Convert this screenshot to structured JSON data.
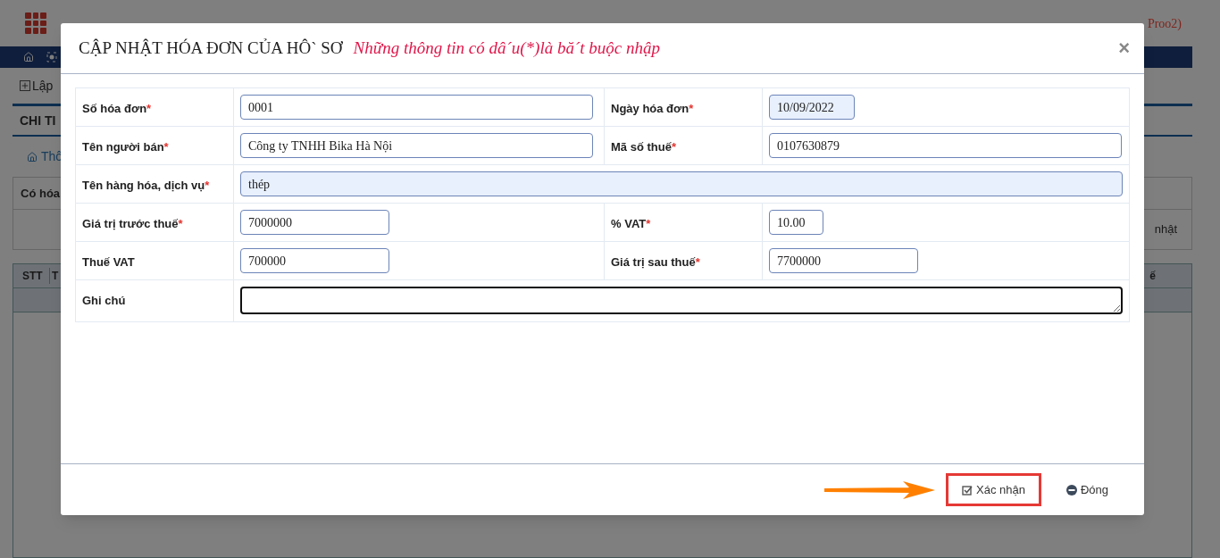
{
  "background": {
    "user_fragments": [
      "Proo2)"
    ],
    "create_link": "Lập",
    "section_title": "CHI TI",
    "breadcrumb": "Thô",
    "filter_label": "Có hóa",
    "update_fragment": "nhật",
    "table_headers": [
      "STT",
      "T",
      "ế"
    ]
  },
  "dialog": {
    "title": "CẬP NHẬT HÓA ĐƠN CỦA HÔ` SƠ",
    "note": "Những thông tin có dâ´u(*)là bă´t buộc nhập",
    "close": "×",
    "rows": [
      {
        "fields": [
          {
            "label": "Số hóa đơn",
            "required_mark": "*",
            "value": "0001",
            "kind": "wide",
            "highlighted": false
          },
          {
            "label": "Ngày hóa đơn",
            "required_mark": "*",
            "value": "10/09/2022",
            "kind": "date",
            "highlighted": true
          }
        ]
      },
      {
        "fields": [
          {
            "label": "Tên người bán",
            "required_mark": "*",
            "value": "Công ty TNHH Bika Hà Nội",
            "kind": "wide",
            "highlighted": false
          },
          {
            "label": "Mã số thuế",
            "required_mark": "*",
            "value": "0107630879",
            "kind": "wide",
            "highlighted": false
          }
        ]
      },
      {
        "fields": [
          {
            "label": "Tên hàng hóa, dịch vụ",
            "required_mark": "*",
            "value": "thép",
            "kind": "full",
            "highlighted": true
          }
        ]
      },
      {
        "fields": [
          {
            "label": "Giá trị trước thuế",
            "required_mark": "*",
            "value": "7000000",
            "kind": "short",
            "highlighted": false
          },
          {
            "label": "% VAT",
            "required_mark": "*",
            "value": "10.00",
            "kind": "tiny",
            "highlighted": false
          }
        ]
      },
      {
        "fields": [
          {
            "label": "Thuế VAT",
            "value": "700000",
            "kind": "short",
            "highlighted": false
          },
          {
            "label": "Giá trị sau thuế",
            "required_mark": "*",
            "value": "7700000",
            "kind": "short",
            "highlighted": false
          }
        ]
      },
      {
        "fields": [
          {
            "label": "Ghi chú",
            "kind": "textarea",
            "focused": true
          }
        ]
      }
    ],
    "buttons": [
      {
        "label": "Xác nhận",
        "kind": "confirm",
        "highlighted": true
      },
      {
        "label": "Đóng",
        "kind": "close",
        "highlighted": false
      }
    ]
  }
}
